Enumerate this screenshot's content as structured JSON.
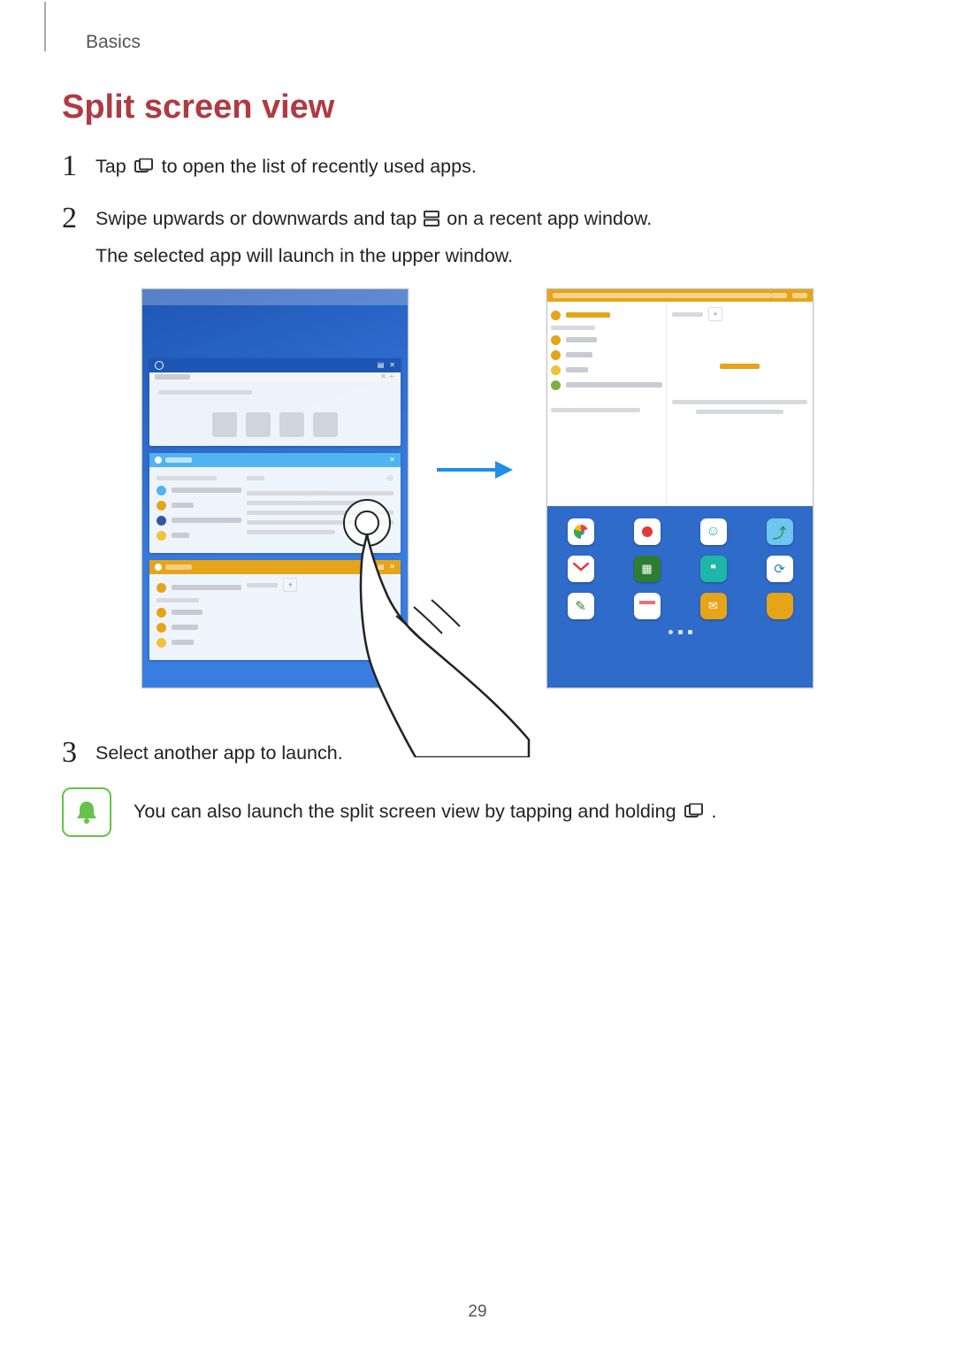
{
  "section": "Basics",
  "title": "Split screen view",
  "steps": {
    "s1": {
      "num": "1",
      "pre": "Tap ",
      "post": " to open the list of recently used apps."
    },
    "s2": {
      "num": "2",
      "pre": "Swipe upwards or downwards and tap ",
      "post": " on a recent app window.",
      "line2": "The selected app will launch in the upper window."
    },
    "s3": {
      "num": "3",
      "text": "Select another app to launch."
    }
  },
  "note": {
    "pre": "You can also launch the split screen view by tapping and holding ",
    "post": "."
  },
  "page_number": "29",
  "icons": {
    "recents": "recents-icon",
    "split": "split-view-icon",
    "tip": "tip-bell-icon"
  }
}
